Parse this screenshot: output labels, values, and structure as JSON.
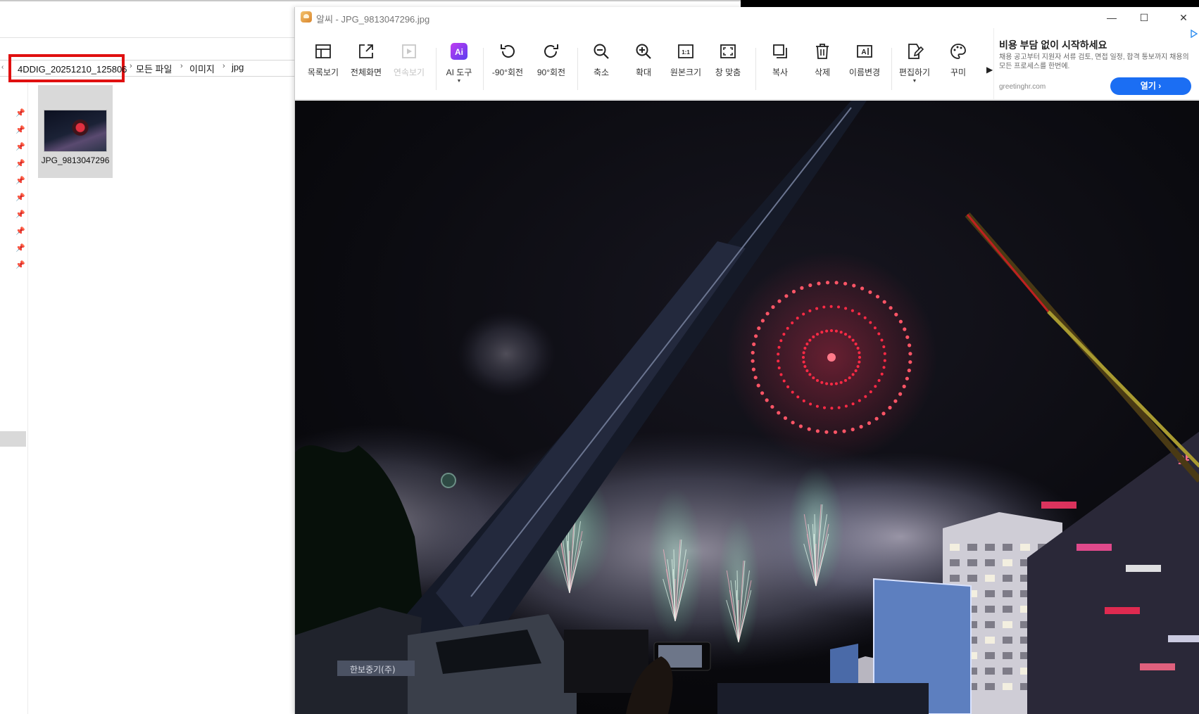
{
  "explorer": {
    "breadcrumb": [
      "4DDIG_20251210_125806",
      "모든 파일",
      "이미지",
      "jpg"
    ],
    "file": {
      "name": "JPG_9813047296"
    }
  },
  "viewer": {
    "title": "알씨 - JPG_9813047296.jpg",
    "window_buttons": {
      "minimize": "—",
      "maximize": "☐",
      "close": "✕"
    },
    "toolbar": [
      {
        "label": "목록보기",
        "icon": "list-view-icon",
        "enabled": true
      },
      {
        "label": "전체화면",
        "icon": "fullscreen-icon",
        "enabled": true
      },
      {
        "label": "연속보기",
        "icon": "slideshow-icon",
        "enabled": false
      },
      {
        "label": "AI 도구",
        "icon": "ai-icon",
        "enabled": true
      },
      {
        "label": "-90°회전",
        "icon": "rotate-left-icon",
        "enabled": true
      },
      {
        "label": "90°회전",
        "icon": "rotate-right-icon",
        "enabled": true
      },
      {
        "label": "축소",
        "icon": "zoom-out-icon",
        "enabled": true
      },
      {
        "label": "확대",
        "icon": "zoom-in-icon",
        "enabled": true
      },
      {
        "label": "원본크기",
        "icon": "actual-size-icon",
        "enabled": true
      },
      {
        "label": "창 맞춤",
        "icon": "fit-window-icon",
        "enabled": true
      },
      {
        "label": "복사",
        "icon": "copy-icon",
        "enabled": true
      },
      {
        "label": "삭제",
        "icon": "trash-icon",
        "enabled": true
      },
      {
        "label": "이름변경",
        "icon": "rename-icon",
        "enabled": true
      },
      {
        "label": "편집하기",
        "icon": "edit-icon",
        "enabled": true
      },
      {
        "label": "꾸미",
        "icon": "palette-icon",
        "enabled": true
      }
    ],
    "ad": {
      "title": "비용 부담 없이 시작하세요",
      "body": "채용 공고부터 지원자 서류 검토, 면접 일정, 합격 통보까지 채용의 모든 프로세스를 한번에.",
      "url": "greetinghr.com",
      "button": "열기 ›"
    },
    "photo": {
      "signs": {
        "crane_company": "한보중기(주)",
        "building_sign": "약"
      }
    }
  },
  "colors": {
    "highlight_box": "#e01010",
    "ad_button": "#1b6ef3",
    "ai_icon": "#8a3df0"
  }
}
